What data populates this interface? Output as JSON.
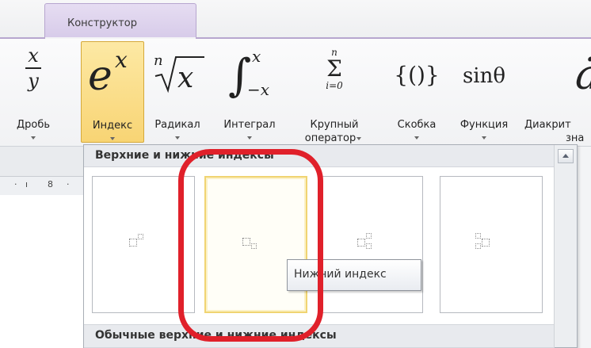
{
  "tab": {
    "label": "Конструктор"
  },
  "ribbon": {
    "buttons": [
      {
        "id": "fraction",
        "label": "Дробь",
        "label2": ""
      },
      {
        "id": "index",
        "label": "Индекс",
        "label2": "",
        "active": true
      },
      {
        "id": "radical",
        "label": "Радикал",
        "label2": ""
      },
      {
        "id": "integral",
        "label": "Интеграл",
        "label2": ""
      },
      {
        "id": "large-operator",
        "label": "Крупный",
        "label2": "оператор"
      },
      {
        "id": "bracket",
        "label": "Скобка",
        "label2": ""
      },
      {
        "id": "function",
        "label": "Функция",
        "label2": ""
      },
      {
        "id": "accent",
        "label": "Диакрит",
        "label2": "зна"
      }
    ]
  },
  "ruler": {
    "mark": "8"
  },
  "dropdown": {
    "section1_title": "Верхние и нижние индексы",
    "section2_title": "Обычные верхние и нижние индексы",
    "items": [
      {
        "name": "superscript"
      },
      {
        "name": "subscript"
      },
      {
        "name": "subscript-superscript"
      },
      {
        "name": "left-subscript-superscript"
      }
    ]
  },
  "tooltip": {
    "text": "Нижний индекс"
  },
  "colors": {
    "annotation_ring": "#e0202a",
    "highlight": "#f8d474",
    "tab": "#d7cbe9"
  }
}
